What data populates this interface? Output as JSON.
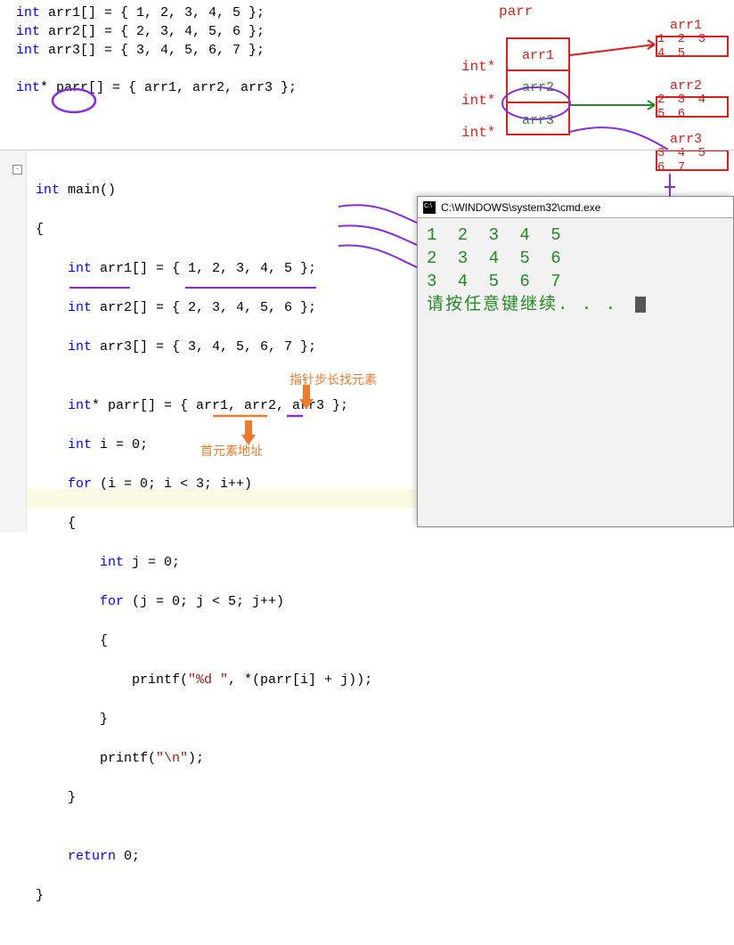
{
  "top": {
    "l1a": "int",
    "l1b": " arr1[] = { 1, 2, 3, 4, 5 };",
    "l2a": "int",
    "l2b": " arr2[] = { 2, 3, 4, 5, 6 };",
    "l3a": "int",
    "l3b": " arr3[] = { 3, 4, 5, 6, 7 };",
    "l4a": "int",
    "l4b": "* parr[] = { arr1, arr2, arr3 };"
  },
  "diagram": {
    "title": "parr",
    "intstar": "int*",
    "cells": [
      "arr1",
      "arr2",
      "arr3"
    ],
    "arrlabels": [
      "arr1",
      "arr2",
      "arr3"
    ],
    "arrvals": [
      "1 2 3 4 5",
      "2 3 4 5 6",
      "3 4 5 6 7"
    ]
  },
  "main": {
    "l1": "int",
    "l1b": " main()",
    "l2": "{",
    "l3_a": "    int",
    "l3_b": " arr1[] = { 1, 2, 3, 4, 5 };",
    "l4_a": "    int",
    "l4_b": " arr2[] = { 2, 3, 4, 5, 6 };",
    "l5_a": "    int",
    "l5_b": " arr3[] = { 3, 4, 5, 6, 7 };",
    "l6": "",
    "l7_a": "    int",
    "l7_b": "* parr[] = { arr1, arr2, arr3 };",
    "l8_a": "    int",
    "l8_b": " i = 0;",
    "l9_a": "    for",
    "l9_b": " (i = 0; i < 3; i++)",
    "l10": "    {",
    "l11_a": "        int",
    "l11_b": " j = 0;",
    "l12_a": "        for",
    "l12_b": " (j = 0; j < 5; j++)",
    "l13": "        {",
    "l14_a": "            printf(",
    "l14_s": "\"%d \"",
    "l14_b": ", *(parr[i] + j));",
    "l15": "        }",
    "l16_a": "        printf(",
    "l16_s": "\"\\n\"",
    "l16_b": ");",
    "l17": "    }",
    "l18": "",
    "l19_a": "    return",
    "l19_b": " 0;",
    "l20": "}"
  },
  "console": {
    "title": "C:\\WINDOWS\\system32\\cmd.exe",
    "r1": "1 2 3 4 5",
    "r2": "2 3 4 5 6",
    "r3": "3 4 5 6 7",
    "prompt": "请按任意键继续. . ."
  },
  "annot": {
    "a1": "指针步长找元素",
    "a2": "首元素地址"
  }
}
